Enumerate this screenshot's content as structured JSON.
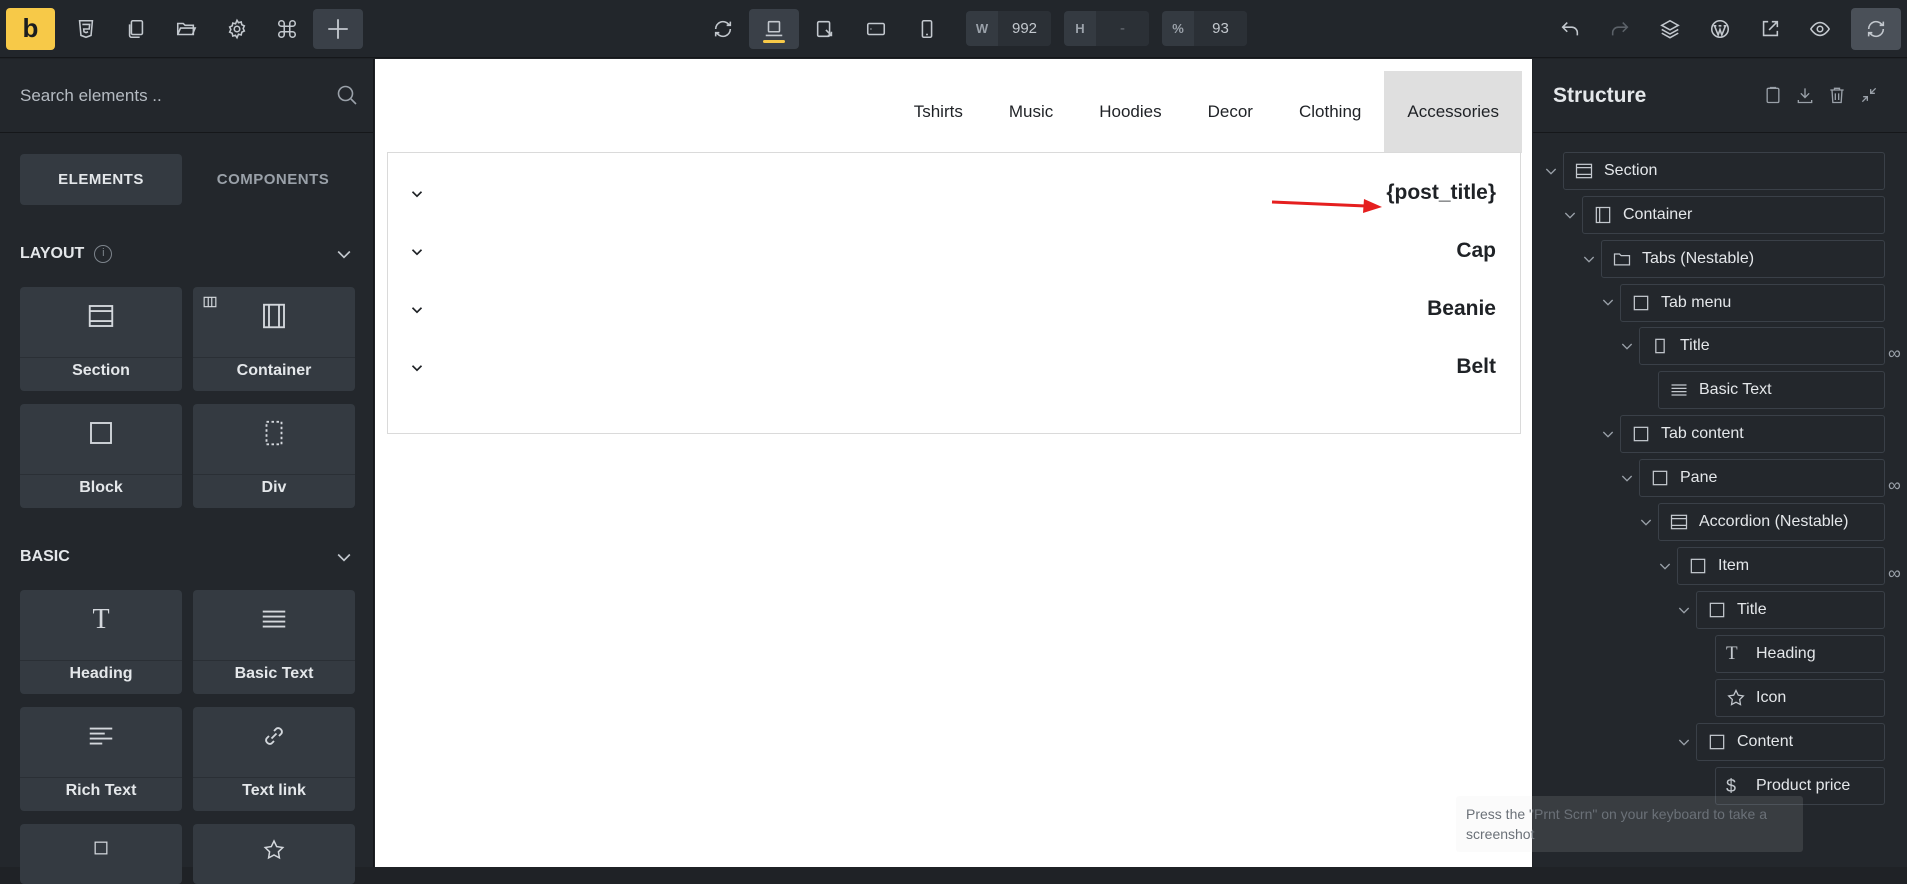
{
  "topbar": {
    "logo": "b",
    "width_label": "W",
    "width_value": "992",
    "height_label": "H",
    "height_value": "-",
    "percent_label": "%",
    "percent_value": "93"
  },
  "left_panel": {
    "search_placeholder": "Search elements ..",
    "tabs": [
      "ELEMENTS",
      "COMPONENTS"
    ],
    "layout_heading": "LAYOUT",
    "basic_heading": "BASIC",
    "layout_items": [
      "Section",
      "Container",
      "Block",
      "Div"
    ],
    "basic_items": [
      "Heading",
      "Basic Text",
      "Rich Text",
      "Text link"
    ]
  },
  "canvas": {
    "nav": [
      "Tshirts",
      "Music",
      "Hoodies",
      "Decor",
      "Clothing",
      "Accessories"
    ],
    "active_nav": "Accessories",
    "accordion": [
      "{post_title}",
      "Cap",
      "Beanie",
      "Belt"
    ]
  },
  "structure": {
    "title": "Structure",
    "nodes": [
      {
        "label": "Section",
        "icon": "section-icon"
      },
      {
        "label": "Container",
        "icon": "container-icon"
      },
      {
        "label": "Tabs (Nestable)",
        "icon": "folder-icon"
      },
      {
        "label": "Tab menu",
        "icon": "block-icon"
      },
      {
        "label": "Title",
        "icon": "doc-icon"
      },
      {
        "label": "Basic Text",
        "icon": "lines-icon"
      },
      {
        "label": "Tab content",
        "icon": "block-icon"
      },
      {
        "label": "Pane",
        "icon": "block-icon"
      },
      {
        "label": "Accordion (Nestable)",
        "icon": "section-icon"
      },
      {
        "label": "Item",
        "icon": "block-icon"
      },
      {
        "label": "Title",
        "icon": "block-icon"
      },
      {
        "label": "Heading",
        "icon": "heading-icon"
      },
      {
        "label": "Icon",
        "icon": "star-icon"
      },
      {
        "label": "Content",
        "icon": "block-icon"
      },
      {
        "label": "Product price",
        "icon": "dollar-icon"
      }
    ]
  },
  "toast": "Press the \"Prnt Scrn\" on your keyboard to take a screenshot",
  "colors": {
    "accent": "#f7c948",
    "panel": "#23272c",
    "arrow": "#e51f1f"
  }
}
